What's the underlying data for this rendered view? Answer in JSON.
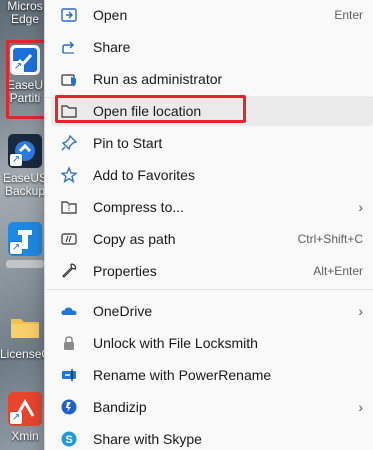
{
  "desktop": {
    "items": [
      {
        "label": "Micros",
        "label2": "Edge"
      },
      {
        "label": "EaseU",
        "label2": "Partiti"
      },
      {
        "label": "EaseUS",
        "label2": "Backup"
      },
      {
        "label": "",
        "label2": ""
      },
      {
        "label": "LicenseC",
        "label2": ""
      },
      {
        "label": "Xmin",
        "label2": ""
      }
    ]
  },
  "menu": {
    "items": [
      {
        "label": "Open",
        "shortcut": "Enter",
        "icon": "open-icon"
      },
      {
        "label": "Share",
        "shortcut": "",
        "icon": "share-icon"
      },
      {
        "label": "Run as administrator",
        "shortcut": "",
        "icon": "shield-icon"
      },
      {
        "label": "Open file location",
        "shortcut": "",
        "icon": "folder-icon"
      },
      {
        "label": "Pin to Start",
        "shortcut": "",
        "icon": "pin-icon"
      },
      {
        "label": "Add to Favorites",
        "shortcut": "",
        "icon": "star-icon"
      },
      {
        "label": "Compress to...",
        "shortcut": "",
        "icon": "zip-folder-icon",
        "submenu": "›"
      },
      {
        "label": "Copy as path",
        "shortcut": "Ctrl+Shift+C",
        "icon": "copy-path-icon"
      },
      {
        "label": "Properties",
        "shortcut": "Alt+Enter",
        "icon": "wrench-icon"
      },
      {
        "label": "OneDrive",
        "shortcut": "",
        "icon": "onedrive-icon",
        "submenu": "›"
      },
      {
        "label": "Unlock with File Locksmith",
        "shortcut": "",
        "icon": "lock-icon"
      },
      {
        "label": "Rename with PowerRename",
        "shortcut": "",
        "icon": "rename-icon"
      },
      {
        "label": "Bandizip",
        "shortcut": "",
        "icon": "bandizip-icon",
        "submenu": "›"
      },
      {
        "label": "Share with Skype",
        "shortcut": "",
        "icon": "skype-icon"
      }
    ]
  },
  "colors": {
    "highlight_box": "#e3262c",
    "accent": "#1e6fd9"
  }
}
